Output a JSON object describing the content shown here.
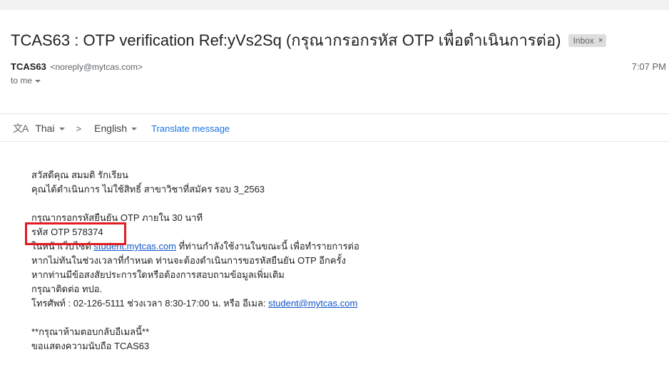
{
  "header": {
    "subject": "TCAS63 : OTP verification Ref:yVs2Sq (กรุณากรอกรหัส OTP เพื่อดำเนินการต่อ)",
    "label_chip": "Inbox",
    "chip_close": "×"
  },
  "sender": {
    "name": "TCAS63",
    "email": "<noreply@mytcas.com>",
    "time": "7:07 PM",
    "to": "to me"
  },
  "translate": {
    "source_lang": "Thai",
    "target_lang": "English",
    "action": "Translate message"
  },
  "body": {
    "greeting": "สวัสดีคุณ สมมติ รักเรียน",
    "line1": "คุณได้ดำเนินการ ไม่ใช้สิทธิ์ สาขาวิชาที่สมัคร รอบ 3_2563",
    "line2": "กรุณากรอกรหัสยืนยัน OTP ภายใน 30 นาที",
    "otp_line": "รหัส OTP 578374",
    "line4_pre": "ในหน้าเว็บไซต์ ",
    "line4_link": "student.mytcas.com",
    "line4_post": " ที่ท่านกำลังใช้งานในขณะนี้ เพื่อทำรายการต่อ",
    "line5": "หากไม่ทันในช่วงเวลาที่กำหนด ท่านจะต้องดำเนินการขอรหัสยืนยัน OTP อีกครั้ง",
    "line6": "หากท่านมีข้อสงสัยประการใดหรือต้องการสอบถามข้อมูลเพิ่มเติม",
    "line7": "กรุณาติดต่อ ทปอ.",
    "line8_pre": "โทรศัพท์ : 02-126-5111 ช่วงเวลา 8:30-17:00 น. หรือ อีเมล: ",
    "line8_link": "student@mytcas.com",
    "warning": "**กรุณาห้ามตอบกลับอีเมลนี้**",
    "closing": "ขอแสดงความนับถือ TCAS63"
  },
  "colors": {
    "highlight": "#e31b23",
    "link": "#1155cc",
    "translate_link": "#1a73e8"
  }
}
